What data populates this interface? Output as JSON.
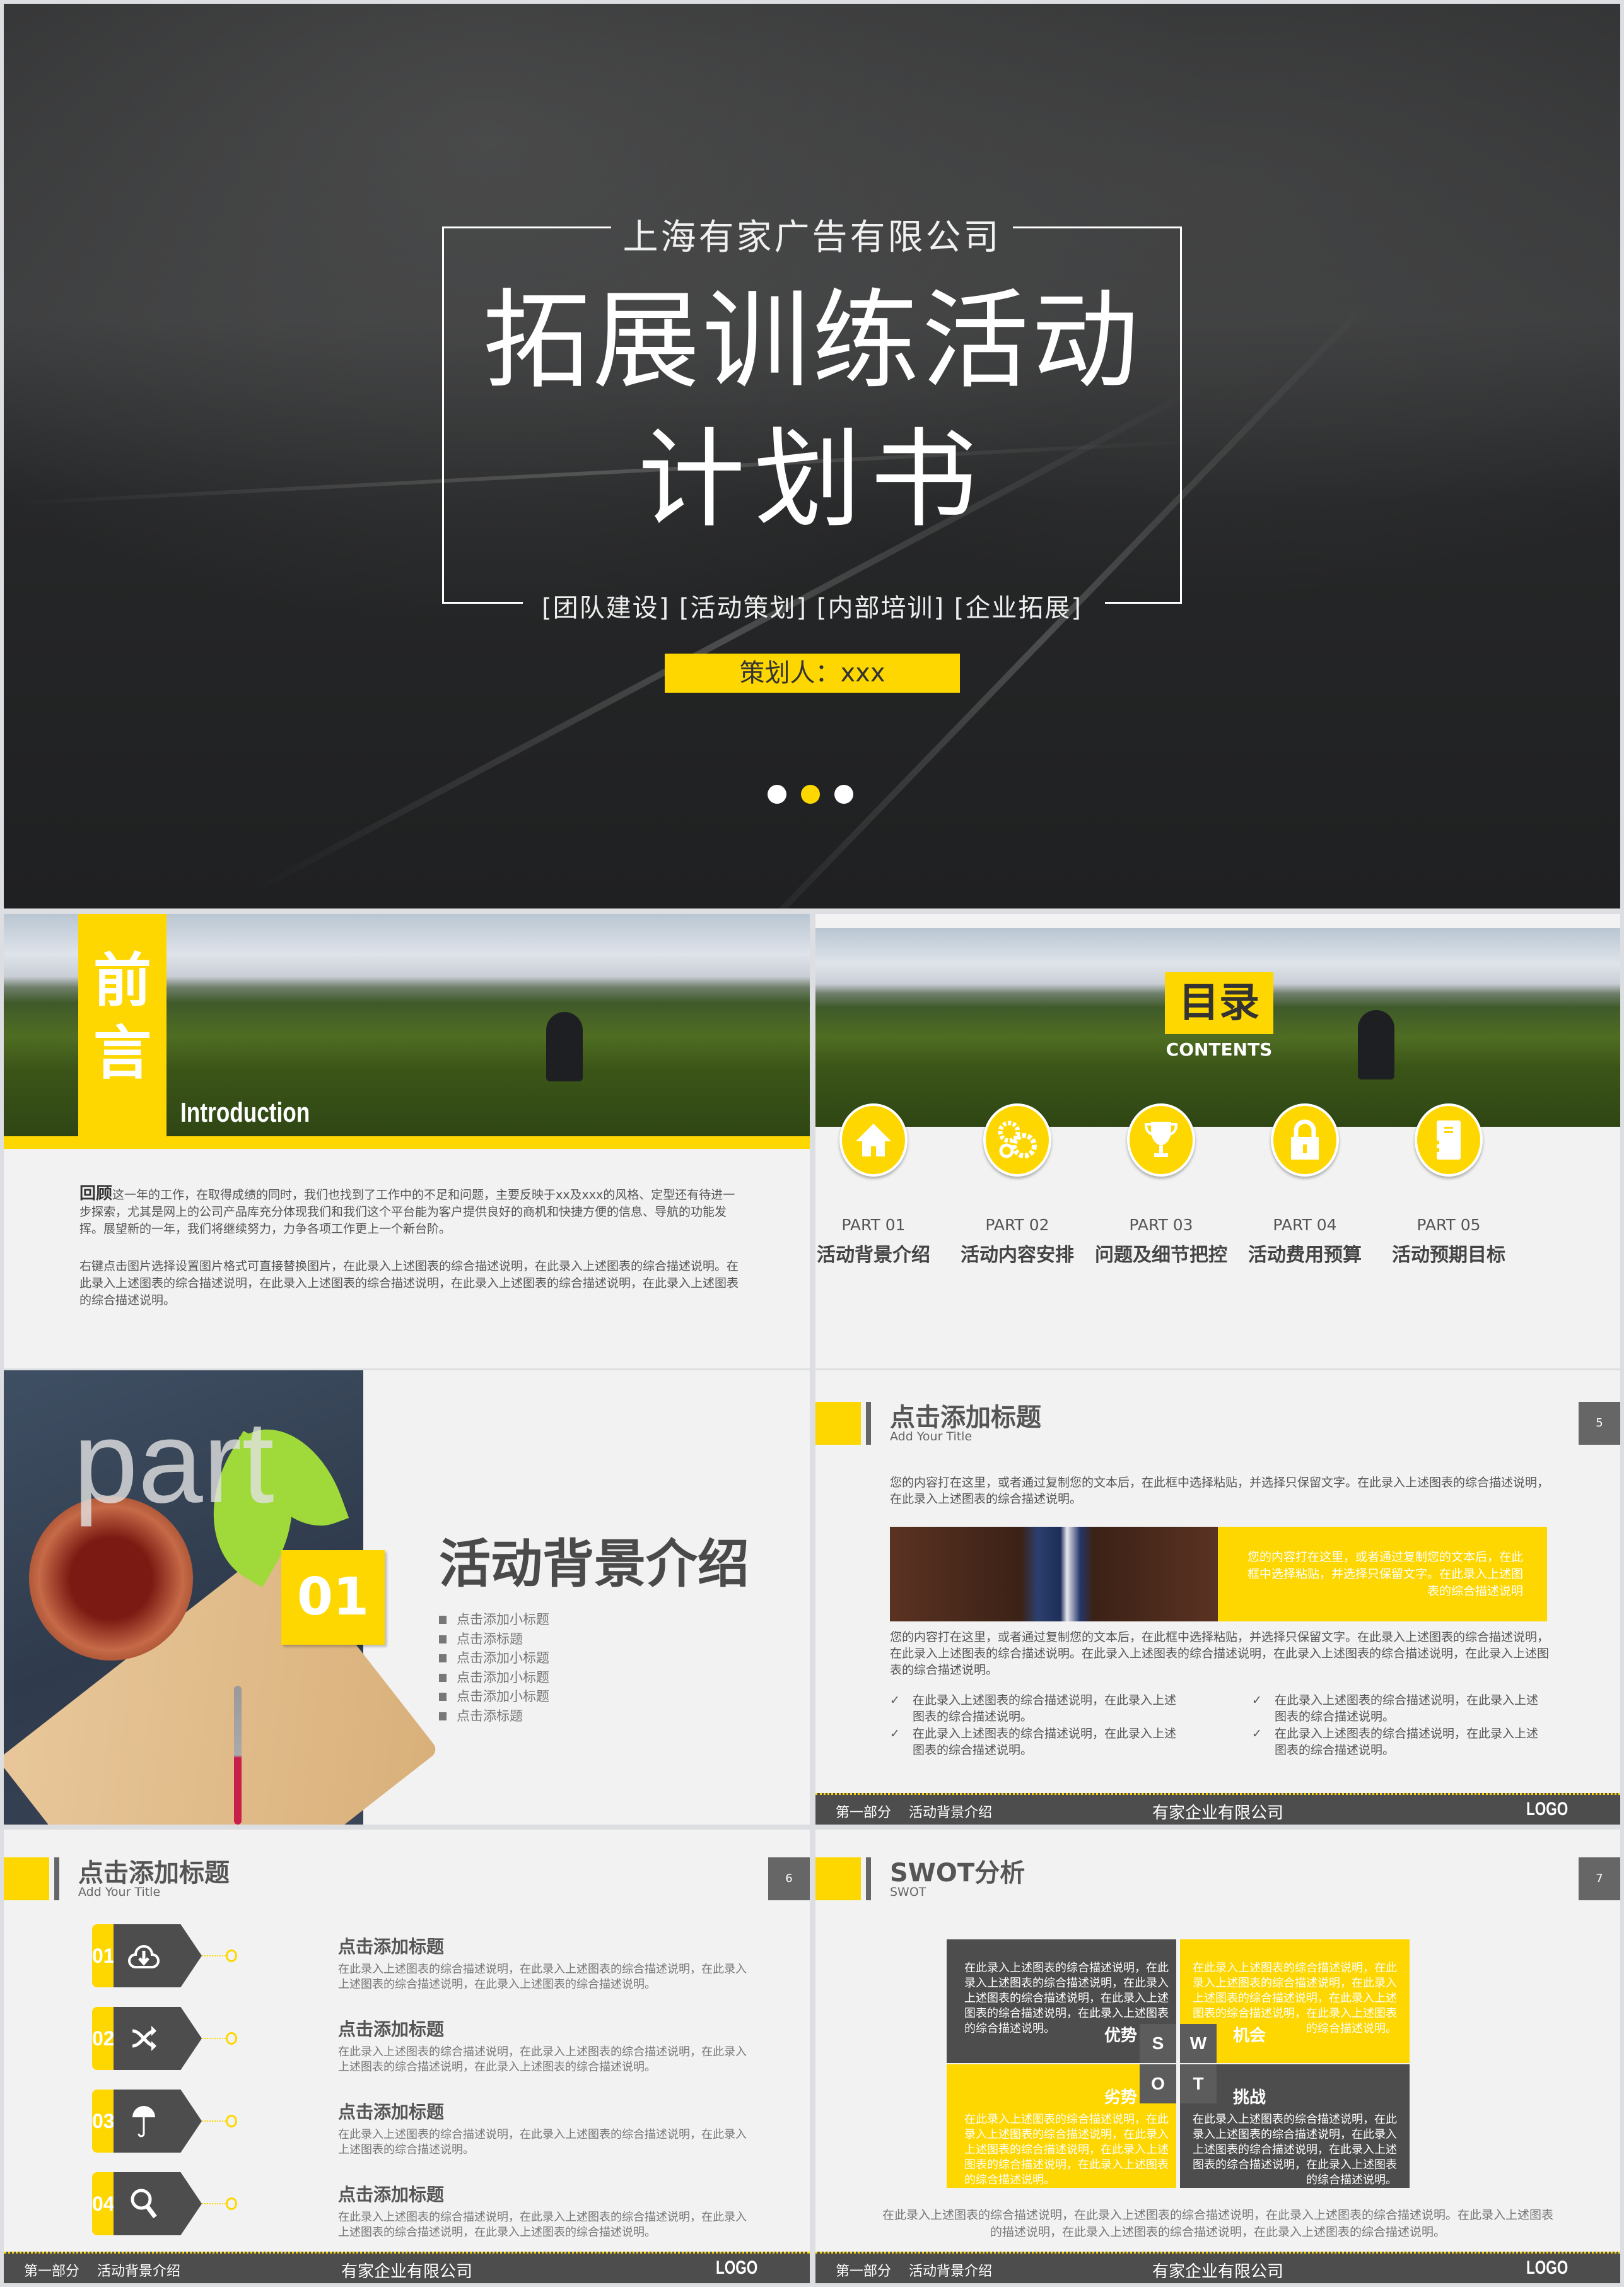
{
  "colors": {
    "accent": "#fed700",
    "dark": "#4d4d4d",
    "background": "#f2f2f2"
  },
  "cover": {
    "company": "上海有家广告有限公司",
    "title_line1": "拓展训练活动",
    "title_line2": "计划书",
    "tags": "[团队建设] [活动策划] [内部培训] [企业拓展]",
    "planner": "策划人：xxx",
    "pagination": {
      "total": 3,
      "active_index": 1
    }
  },
  "foreword": {
    "tag_chars": [
      "前",
      "言"
    ],
    "tag_en": "Introduction",
    "para1_lead": "回顾",
    "para1": "这一年的工作，在取得成绩的同时，我们也找到了工作中的不足和问题，主要反映于xx及xxx的风格、定型还有待进一步探索，尤其是网上的公司产品库充分体现我们和我们这个平台能为客户提供良好的商机和快捷方便的信息、导航的功能发挥。展望新的一年，我们将继续努力，力争各项工作更上一个新台阶。",
    "para2": "右键点击图片选择设置图片格式可直接替换图片，在此录入上述图表的综合描述说明，在此录入上述图表的综合描述说明。在此录入上述图表的综合描述说明，在此录入上述图表的综合描述说明，在此录入上述图表的综合描述说明，在此录入上述图表的综合描述说明。"
  },
  "contents": {
    "title": "目录",
    "title_en": "CONTENTS",
    "items": [
      {
        "part": "PART 01",
        "label": "活动背景介绍",
        "icon": "home-icon"
      },
      {
        "part": "PART 02",
        "label": "活动内容安排",
        "icon": "gears-icon"
      },
      {
        "part": "PART 03",
        "label": "问题及细节把控",
        "icon": "trophy-icon"
      },
      {
        "part": "PART 04",
        "label": "活动费用预算",
        "icon": "lock-icon"
      },
      {
        "part": "PART 05",
        "label": "活动预期目标",
        "icon": "document-icon"
      }
    ]
  },
  "section1": {
    "part_word": "part",
    "number": "01",
    "title": "活动背景介绍",
    "subtitles": [
      "点击添加小标题",
      "点击添标题",
      "点击添加小标题",
      "点击添加小标题",
      "点击添加小标题",
      "点击添标题"
    ]
  },
  "footer": {
    "section": "第一部分",
    "section_name": "活动背景介绍",
    "company": "有家企业有限公司",
    "logo": "LOGO"
  },
  "slide5": {
    "title": "点击添加标题",
    "subtitle": "Add Your Title",
    "page": "5",
    "intro": "您的内容打在这里，或者通过复制您的文本后，在此框中选择粘贴，并选择只保留文字。在此录入上述图表的综合描述说明，在此录入上述图表的综合描述说明。",
    "highlight": "您的内容打在这里，或者通过复制您的文本后，在此框中选择粘贴，并选择只保留文字。在此录入上述图表的综合描述说明",
    "body": "您的内容打在这里，或者通过复制您的文本后，在此框中选择粘贴，并选择只保留文字。在此录入上述图表的综合描述说明，在此录入上述图表的综合描述说明。在此录入上述图表的综合描述说明，在此录入上述图表的综合描述说明，在此录入上述图表的综合描述说明。",
    "checks_left": [
      "在此录入上述图表的综合描述说明，在此录入上述图表的综合描述说明。",
      "在此录入上述图表的综合描述说明，在此录入上述图表的综合描述说明。"
    ],
    "checks_right": [
      "在此录入上述图表的综合描述说明，在此录入上述图表的综合描述说明。",
      "在此录入上述图表的综合描述说明，在此录入上述图表的综合描述说明。"
    ]
  },
  "slide6": {
    "title": "点击添加标题",
    "subtitle": "Add Your Title",
    "page": "6",
    "steps": [
      {
        "num": "01",
        "icon": "cloud-download-icon",
        "title": "点击添加标题",
        "desc": "在此录入上述图表的综合描述说明，在此录入上述图表的综合描述说明，在此录入上述图表的综合描述说明，在此录入上述图表的综合描述说明。"
      },
      {
        "num": "02",
        "icon": "shuffle-icon",
        "title": "点击添加标题",
        "desc": "在此录入上述图表的综合描述说明，在此录入上述图表的综合描述说明，在此录入上述图表的综合描述说明，在此录入上述图表的综合描述说明。"
      },
      {
        "num": "03",
        "icon": "umbrella-icon",
        "title": "点击添加标题",
        "desc": "在此录入上述图表的综合描述说明，在此录入上述图表的综合描述说明，在此录入上述图表的综合描述说明。"
      },
      {
        "num": "04",
        "icon": "search-icon",
        "title": "点击添加标题",
        "desc": "在此录入上述图表的综合描述说明，在此录入上述图表的综合描述说明，在此录入上述图表的综合描述说明，在此录入上述图表的综合描述说明。"
      }
    ]
  },
  "slide7": {
    "title": "SWOT分析",
    "subtitle": "SWOT",
    "page": "7",
    "quadrants": [
      {
        "letter": "S",
        "heading": "优势",
        "text": "在此录入上述图表的综合描述说明，在此录入上述图表的综合描述说明，在此录入上述图表的综合描述说明，在此录入上述图表的综合描述说明，在此录入上述图表的综合描述说明。"
      },
      {
        "letter": "W",
        "heading": "机会",
        "text": "在此录入上述图表的综合描述说明，在此录入上述图表的综合描述说明，在此录入上述图表的综合描述说明，在此录入上述图表的综合描述说明，在此录入上述图表的综合描述说明。"
      },
      {
        "letter": "O",
        "heading": "劣势",
        "text": "在此录入上述图表的综合描述说明，在此录入上述图表的综合描述说明，在此录入上述图表的综合描述说明，在此录入上述图表的综合描述说明，在此录入上述图表的综合描述说明。"
      },
      {
        "letter": "T",
        "heading": "挑战",
        "text": "在此录入上述图表的综合描述说明，在此录入上述图表的综合描述说明，在此录入上述图表的综合描述说明，在此录入上述图表的综合描述说明，在此录入上述图表的综合描述说明。"
      }
    ],
    "note": "在此录入上述图表的综合描述说明，在此录入上述图表的综合描述说明，在此录入上述图表的综合描述说明。在此录入上述图表的描述说明，在此录入上述图表的综合描述说明，在此录入上述图表的综合描述说明。"
  }
}
